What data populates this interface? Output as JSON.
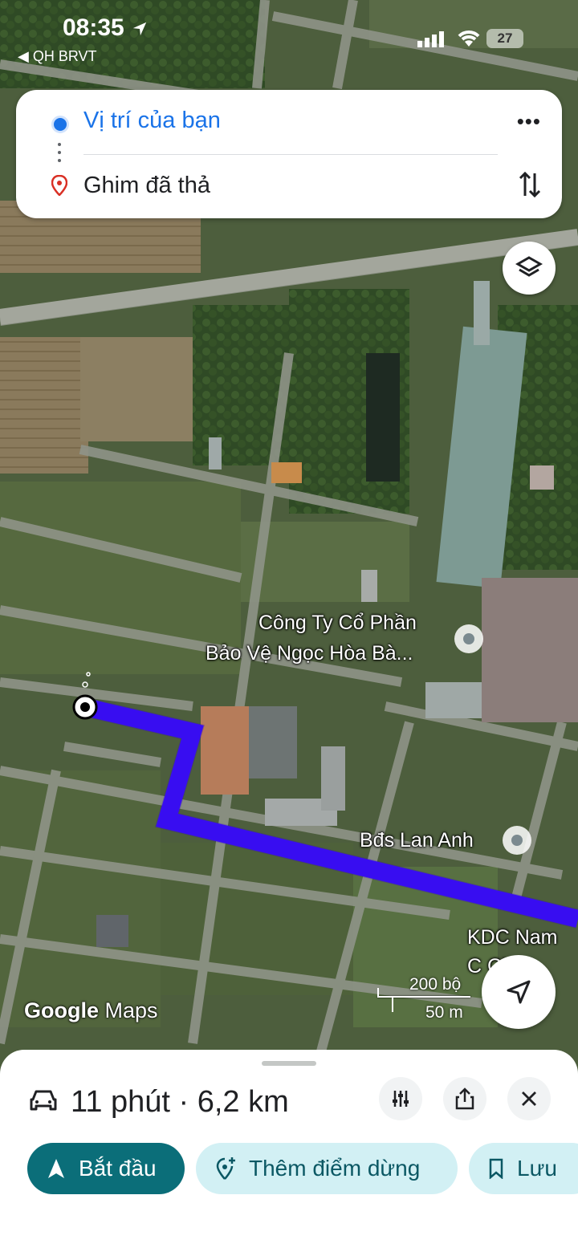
{
  "status_bar": {
    "time": "08:35",
    "back_label": "◀ QH BRVT",
    "battery": "27"
  },
  "directions": {
    "origin": "Vị trí của bạn",
    "destination": "Ghim đã thả",
    "more_label": "•••"
  },
  "map": {
    "poi_company_line1": "Công Ty Cổ Phần",
    "poi_company_line2": "Bảo Vệ Ngọc Hòa Bà...",
    "poi_bds": "Bđs Lan Anh",
    "poi_kdc_line1": "KDC Nam",
    "poi_kdc_line2": "C    Cit",
    "scale_top": "200 bộ",
    "scale_bottom": "50 m",
    "attribution_google": "Google",
    "attribution_maps": "Maps",
    "route_color": "#3c12ff"
  },
  "route_sheet": {
    "summary": "11 phút · 6,2 km",
    "start_label": "Bắt đầu",
    "add_stop_label": "Thêm điểm dừng",
    "save_label": "Lưu"
  },
  "icons": [
    "location-arrow-icon",
    "signal-icon",
    "wifi-icon",
    "battery-icon",
    "swap-icon",
    "layers-icon",
    "car-icon",
    "options-icon",
    "share-icon",
    "close-icon",
    "navigation-icon",
    "add-stop-icon",
    "bookmark-icon",
    "pin-icon"
  ]
}
